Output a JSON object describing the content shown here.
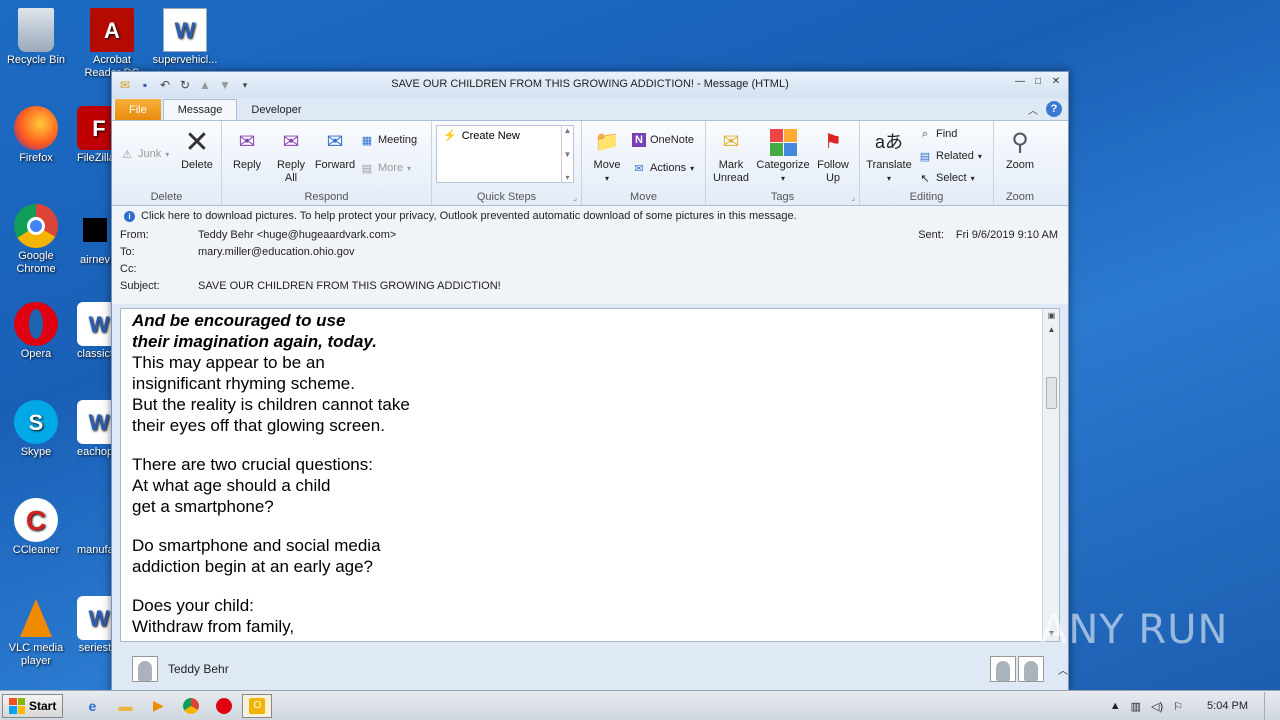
{
  "desktop": {
    "icons": [
      {
        "label": "Recycle Bin"
      },
      {
        "label": "Acrobat Reader DC"
      },
      {
        "label": "supervehicl..."
      },
      {
        "label": "Firefox"
      },
      {
        "label": "FileZilla"
      },
      {
        "label": "Google Chrome"
      },
      {
        "label": "airnev"
      },
      {
        "label": "Opera"
      },
      {
        "label": "classict"
      },
      {
        "label": "Skype"
      },
      {
        "label": "eachop"
      },
      {
        "label": "CCleaner"
      },
      {
        "label": "manufa"
      },
      {
        "label": "VLC media player"
      },
      {
        "label": "seriest"
      }
    ]
  },
  "window": {
    "title": "SAVE OUR CHILDREN FROM THIS GROWING ADDICTION!  -  Message (HTML)"
  },
  "tabs": {
    "file": "File",
    "message": "Message",
    "developer": "Developer"
  },
  "ribbon": {
    "delete_group": {
      "label": "Delete",
      "junk": "Junk",
      "delete": "Delete"
    },
    "respond_group": {
      "label": "Respond",
      "reply": "Reply",
      "reply_all": "Reply All",
      "forward": "Forward",
      "meeting": "Meeting",
      "more": "More"
    },
    "quicksteps_group": {
      "label": "Quick Steps",
      "create_new": "Create New"
    },
    "move_group": {
      "label": "Move",
      "move": "Move",
      "onenote": "OneNote",
      "actions": "Actions"
    },
    "tags_group": {
      "label": "Tags",
      "mark_unread": "Mark Unread",
      "categorize": "Categorize",
      "follow_up": "Follow Up"
    },
    "editing_group": {
      "label": "Editing",
      "translate": "Translate",
      "find": "Find",
      "related": "Related",
      "select": "Select"
    },
    "zoom_group": {
      "label": "Zoom",
      "zoom": "Zoom"
    }
  },
  "infobar": {
    "text": "Click here to download pictures. To help protect your privacy, Outlook prevented automatic download of some pictures in this message."
  },
  "headers": {
    "from_label": "From:",
    "from_value": "Teddy Behr <huge@hugeaardvark.com>",
    "to_label": "To:",
    "to_value": "mary.miller@education.ohio.gov",
    "cc_label": "Cc:",
    "cc_value": "",
    "subject_label": "Subject:",
    "subject_value": "SAVE OUR CHILDREN FROM THIS GROWING ADDICTION!",
    "sent_label": "Sent:",
    "sent_value": "Fri 9/6/2019 9:10 AM"
  },
  "body": {
    "line1": "And be encouraged to use",
    "line2": "their imagination again, today.",
    "line3": "This may appear to be an",
    "line4": "insignificant rhyming scheme.",
    "line5": "But the reality is children cannot take",
    "line6": "their eyes off that glowing screen.",
    "line7": "There are two crucial questions:",
    "line8": "At what age should a child",
    "line9": "get a smartphone?",
    "line10": "Do smartphone and social media",
    "line11": "addiction begin at an early age?",
    "line12": "Does your child:",
    "line13": "Withdraw from family,"
  },
  "people_pane": {
    "name": "Teddy Behr"
  },
  "taskbar": {
    "start": "Start",
    "time": "5:04 PM"
  },
  "watermark": "ANY RUN"
}
